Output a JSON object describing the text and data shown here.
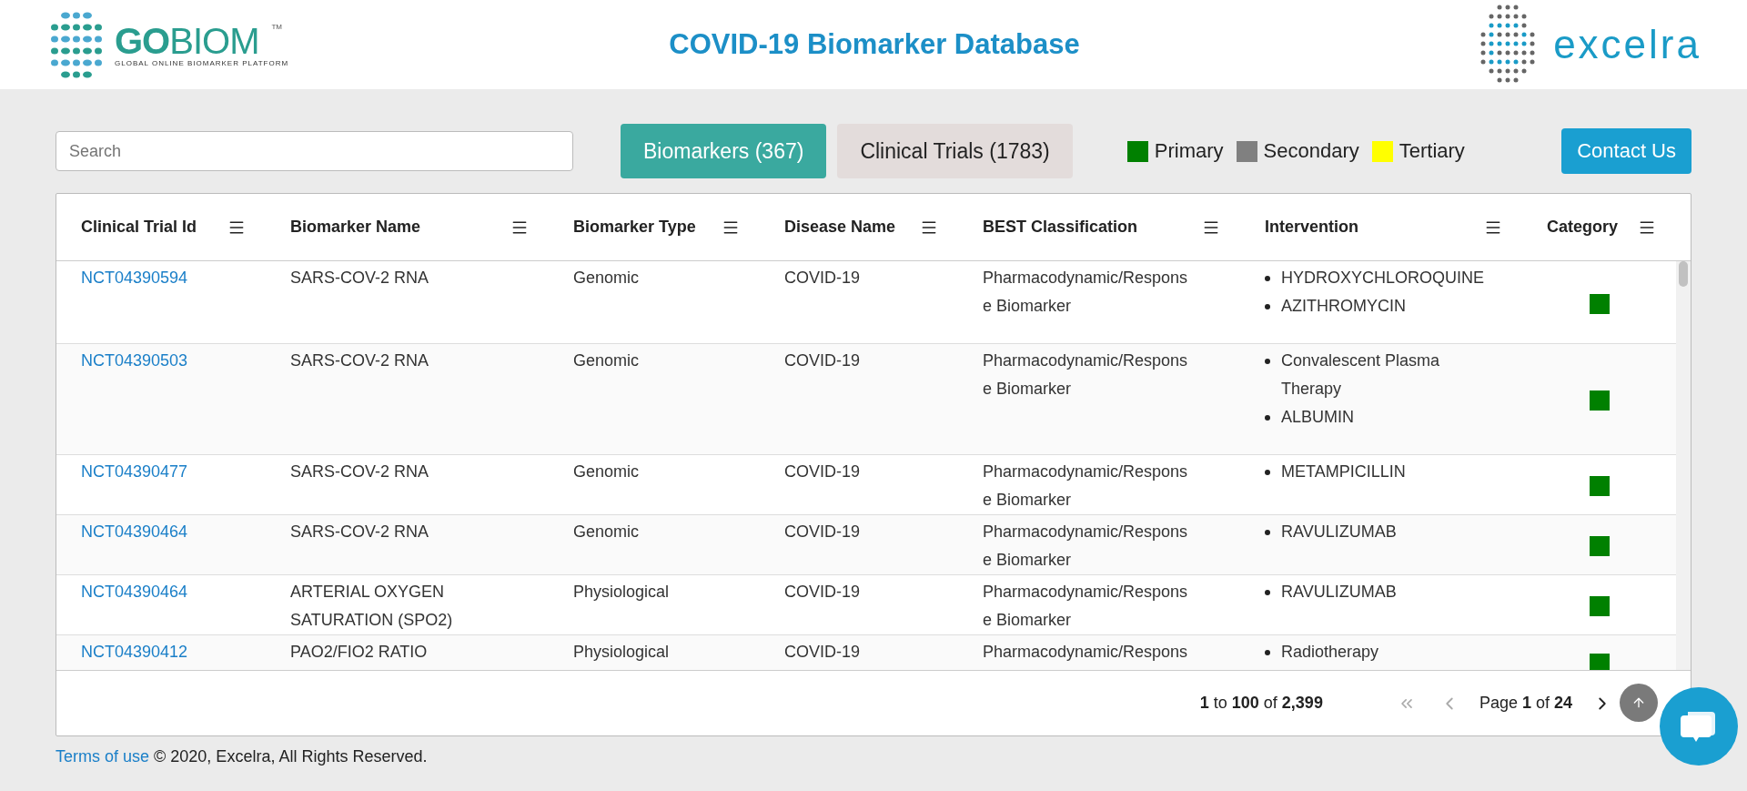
{
  "header": {
    "logo_left": {
      "part_1": "GO",
      "part_2": "BIOM",
      "trademark": "TM",
      "tagline": "GLOBAL ONLINE BIOMARKER PLATFORM"
    },
    "title": "COVID-19 Biomarker Database",
    "logo_right": "excelra"
  },
  "toolbar": {
    "search": {
      "placeholder": "Search"
    },
    "tabs": [
      {
        "label": "Biomarkers (367)",
        "selected": true
      },
      {
        "label": "Clinical Trials (1783)",
        "selected": false
      }
    ],
    "legend": [
      {
        "label": "Primary",
        "color": "#008000"
      },
      {
        "label": "Secondary",
        "color": "#808080"
      },
      {
        "label": "Tertiary",
        "color": "#ffff00"
      }
    ],
    "contact_button": "Contact Us"
  },
  "table": {
    "columns": [
      "Clinical Trial Id",
      "Biomarker Name",
      "Biomarker Type",
      "Disease Name",
      "BEST Classification",
      "Intervention",
      "Category"
    ],
    "rows": [
      {
        "trial_id": "NCT04390594",
        "biomarker_name": "SARS-COV-2 RNA",
        "biomarker_type": "Genomic",
        "disease": "COVID-19",
        "classification": "Pharmacodynamic/Response Biomarker",
        "interventions": [
          "HYDROXYCHLOROQUINE",
          "AZITHROMYCIN"
        ],
        "color": "#008000"
      },
      {
        "trial_id": "NCT04390503",
        "biomarker_name": "SARS-COV-2 RNA",
        "biomarker_type": "Genomic",
        "disease": "COVID-19",
        "classification": "Pharmacodynamic/Response Biomarker",
        "interventions": [
          "Convalescent Plasma Therapy",
          "ALBUMIN"
        ],
        "color": "#008000"
      },
      {
        "trial_id": "NCT04390477",
        "biomarker_name": "SARS-COV-2 RNA",
        "biomarker_type": "Genomic",
        "disease": "COVID-19",
        "classification": "Pharmacodynamic/Response Biomarker",
        "interventions": [
          "METAMPICILLIN"
        ],
        "color": "#008000"
      },
      {
        "trial_id": "NCT04390464",
        "biomarker_name": "SARS-COV-2 RNA",
        "biomarker_type": "Genomic",
        "disease": "COVID-19",
        "classification": "Pharmacodynamic/Response Biomarker",
        "interventions": [
          "RAVULIZUMAB"
        ],
        "color": "#008000"
      },
      {
        "trial_id": "NCT04390464",
        "biomarker_name": "ARTERIAL OXYGEN SATURATION (SPO2)",
        "biomarker_type": "Physiological",
        "disease": "COVID-19",
        "classification": "Pharmacodynamic/Response Biomarker",
        "interventions": [
          "RAVULIZUMAB"
        ],
        "color": "#008000"
      },
      {
        "trial_id": "NCT04390412",
        "biomarker_name": "PAO2/FIO2 RATIO",
        "biomarker_type": "Physiological",
        "disease": "COVID-19",
        "classification": "Pharmacodynamic/Respons",
        "interventions": [
          "Radiotherapy"
        ],
        "color": "#008000"
      }
    ],
    "pagination": {
      "range": "**1** to **100** of **2,399**",
      "page": "Page **1** of **24**"
    }
  },
  "footer": {
    "link": "Terms of use",
    "text": "© 2020, Excelra, All Rights Reserved."
  }
}
